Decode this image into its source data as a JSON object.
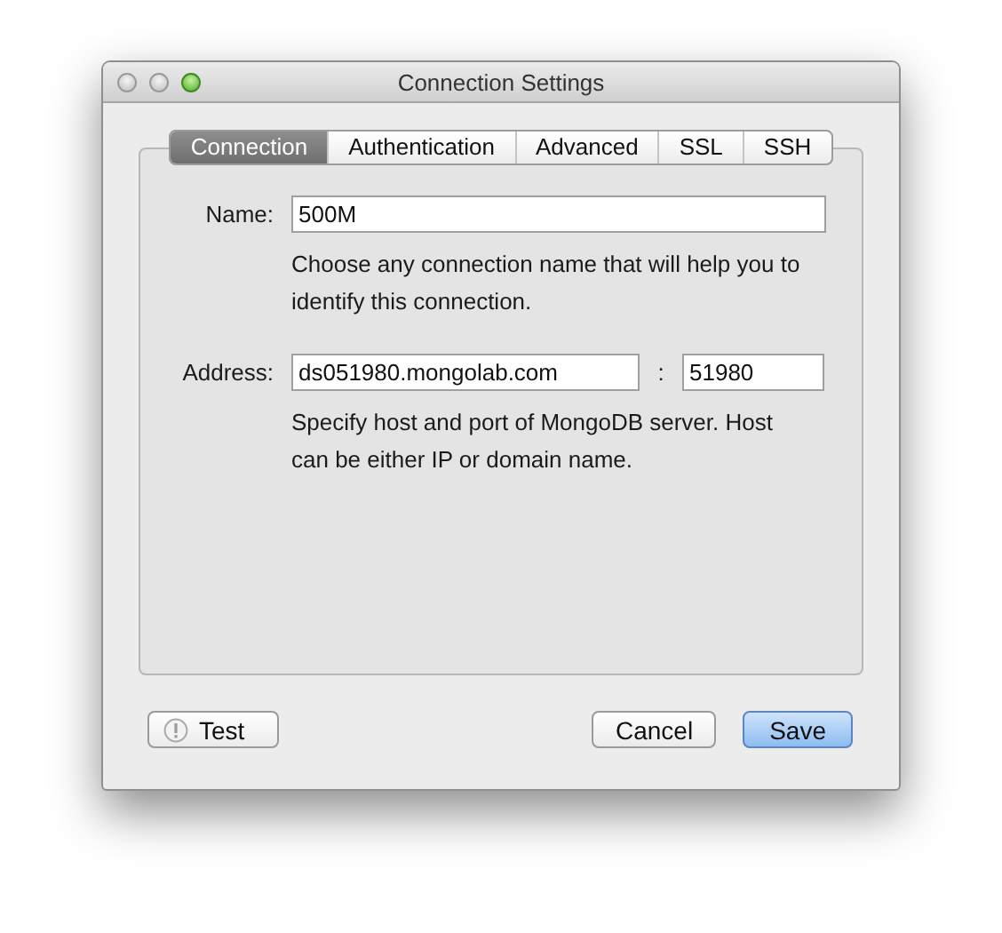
{
  "window": {
    "title": "Connection Settings",
    "traffic_lights": [
      {
        "kind": "close",
        "active": false
      },
      {
        "kind": "minimize",
        "active": false
      },
      {
        "kind": "zoom",
        "active": true
      }
    ]
  },
  "tabs": [
    {
      "label": "Connection",
      "selected": true
    },
    {
      "label": "Authentication",
      "selected": false
    },
    {
      "label": "Advanced",
      "selected": false
    },
    {
      "label": "SSL",
      "selected": false
    },
    {
      "label": "SSH",
      "selected": false
    }
  ],
  "fields": [
    {
      "label": "Name:",
      "value": "500M",
      "hint": "Choose any connection name that will help you to identify this connection."
    },
    {
      "label": "Address:",
      "value": "ds051980.mongolab.com",
      "separator": ":",
      "port": "51980",
      "hint": "Specify host and port of MongoDB server. Host can be either IP or domain name."
    }
  ],
  "buttons": [
    {
      "label": "Test",
      "kind": "test"
    },
    {
      "label": "Cancel",
      "kind": "normal"
    },
    {
      "label": "Save",
      "kind": "default"
    }
  ]
}
